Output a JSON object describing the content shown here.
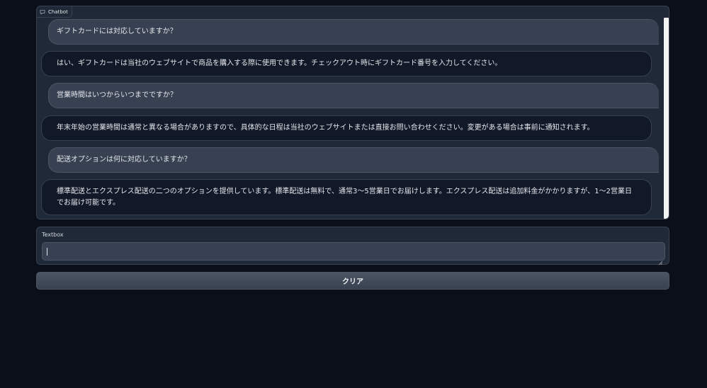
{
  "chatbot": {
    "label": "Chatbot",
    "icon": "chat-bubble-icon",
    "messages": [
      {
        "role": "user",
        "text": "ギフトカードには対応していますか？"
      },
      {
        "role": "bot",
        "text": "はい、ギフトカードは当社のウェブサイトで商品を購入する際に使用できます。チェックアウト時にギフトカード番号を入力してください。"
      },
      {
        "role": "user",
        "text": "営業時間はいつからいつまでですか？"
      },
      {
        "role": "bot",
        "text": "年末年始の営業時間は通常と異なる場合がありますので、具体的な日程は当社のウェブサイトまたは直接お問い合わせください。変更がある場合は事前に通知されます。"
      },
      {
        "role": "user",
        "text": "配送オプションは何に対応していますか？"
      },
      {
        "role": "bot",
        "text": "標準配送とエクスプレス配送の二つのオプションを提供しています。標準配送は無料で、通常3〜5営業日でお届けします。エクスプレス配送は追加料金がかかりますが、1〜2営業日でお届け可能です。"
      }
    ]
  },
  "textbox": {
    "label": "Textbox",
    "value": ""
  },
  "clear_button": {
    "label": "クリア"
  },
  "colors": {
    "background": "#0b0f19",
    "panel": "#1f2937",
    "user_bubble": "#374151",
    "bot_bubble": "#111827",
    "text": "#e5e7eb"
  }
}
